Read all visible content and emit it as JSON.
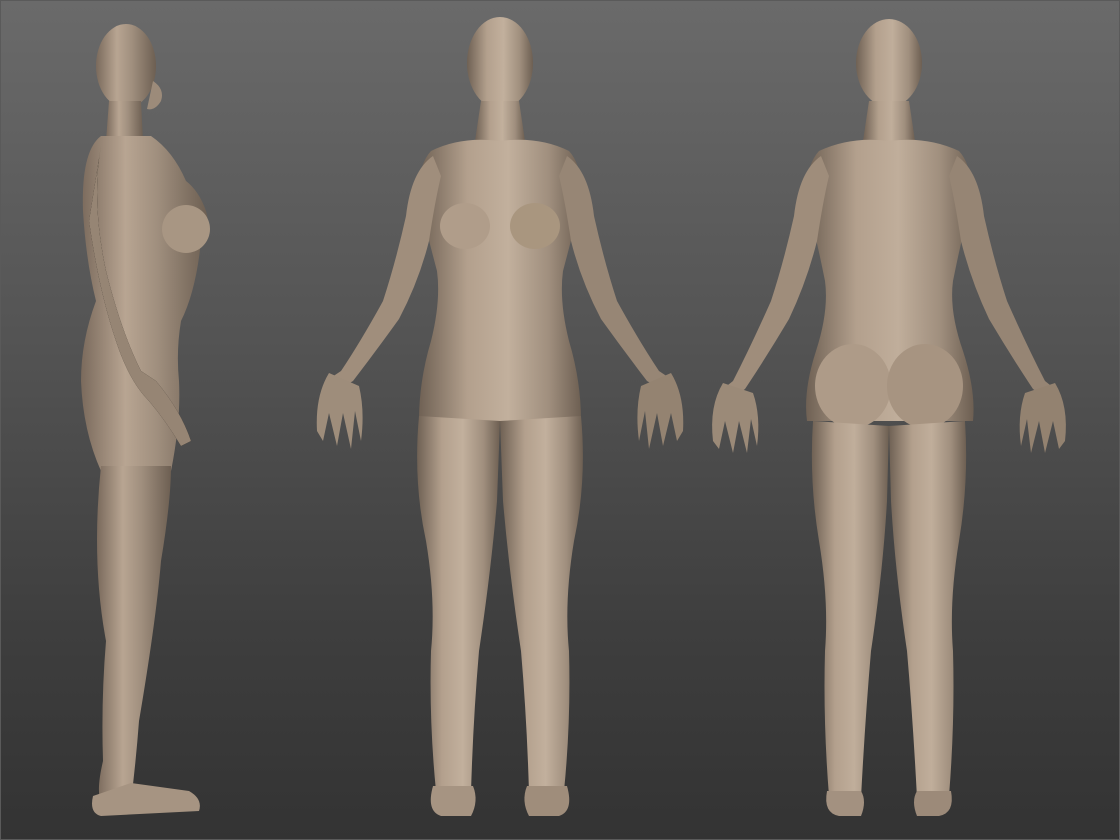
{
  "scene": {
    "background_top": "#6a6a6a",
    "background_bottom": "#333333",
    "clay_color": "#a08f7e",
    "clay_highlight": "#c7b6a4",
    "clay_shadow": "#6d5f52"
  },
  "views": [
    {
      "name": "side",
      "icon": "figure-side-view"
    },
    {
      "name": "front",
      "icon": "figure-front-view"
    },
    {
      "name": "back",
      "icon": "figure-back-view"
    }
  ]
}
